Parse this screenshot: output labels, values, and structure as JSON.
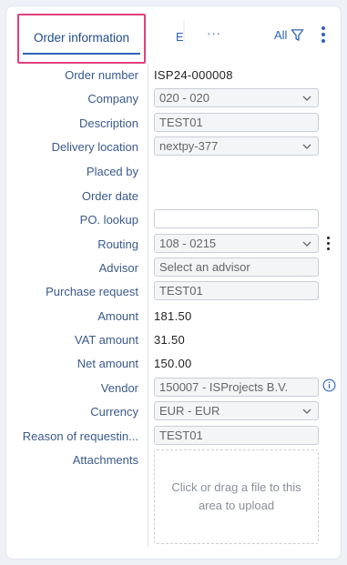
{
  "tabs": {
    "active_label": "Order information",
    "second_label": "E",
    "more_label": "···",
    "filter_label": "All"
  },
  "fields": {
    "order_number": {
      "label": "Order number",
      "value": "ISP24-000008"
    },
    "company": {
      "label": "Company",
      "value": "020 - 020"
    },
    "description": {
      "label": "Description",
      "value": "TEST01"
    },
    "delivery_location": {
      "label": "Delivery location",
      "value": "nextpy-377"
    },
    "placed_by": {
      "label": "Placed by",
      "value": ""
    },
    "order_date": {
      "label": "Order date",
      "value": ""
    },
    "po_lookup": {
      "label": "PO. lookup",
      "value": ""
    },
    "routing": {
      "label": "Routing",
      "value": "108 - 0215"
    },
    "advisor": {
      "label": "Advisor",
      "placeholder": "Select an advisor"
    },
    "purchase_request": {
      "label": "Purchase request",
      "value": "TEST01"
    },
    "amount": {
      "label": "Amount",
      "value": "181.50"
    },
    "vat_amount": {
      "label": "VAT amount",
      "value": "31.50"
    },
    "net_amount": {
      "label": "Net amount",
      "value": "150.00"
    },
    "vendor": {
      "label": "Vendor",
      "value": "150007 - ISProjects B.V."
    },
    "currency": {
      "label": "Currency",
      "value": "EUR - EUR"
    },
    "reason": {
      "label": "Reason of requestin...",
      "value": "TEST01"
    },
    "attachments": {
      "label": "Attachments",
      "upload_text": "Click or drag a file to this area to upload"
    }
  },
  "icons": {
    "accent": "#2f62b8",
    "highlight": "#e0417f"
  }
}
